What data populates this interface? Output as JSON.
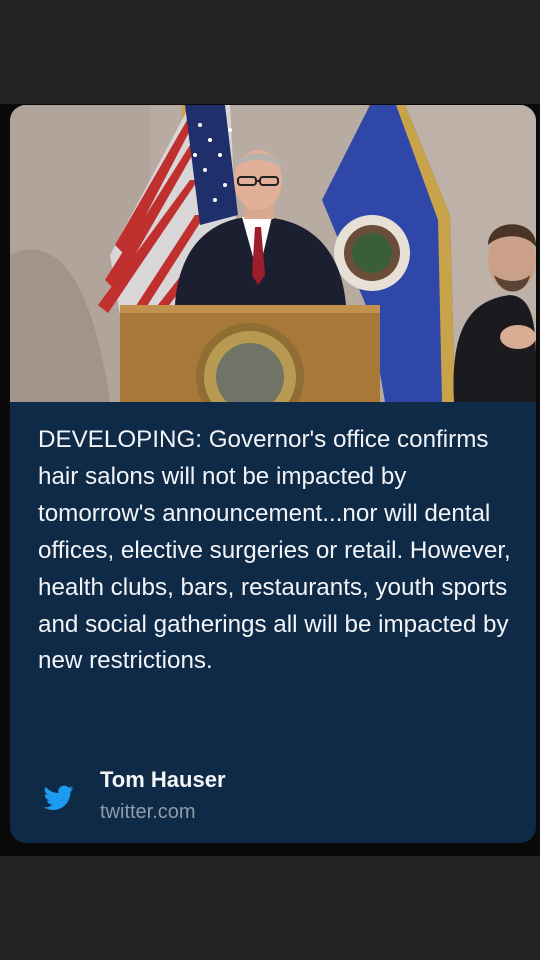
{
  "card": {
    "headline": "DEVELOPING: Governor's office confirms hair salons will not be impacted by tomorrow's announcement...nor will dental offices, elective surgeries or retail. However, health clubs, bars, restaurants, youth sports and social gatherings all will be impacted by new restrictions.",
    "author": "Tom Hauser",
    "domain": "twitter.com",
    "icon": "twitter-bird-icon"
  },
  "colors": {
    "card_background": "#0f2a47",
    "twitter_blue": "#1d9bf0",
    "headline_text": "#f2f4f7",
    "domain_text": "#8d9bab"
  }
}
